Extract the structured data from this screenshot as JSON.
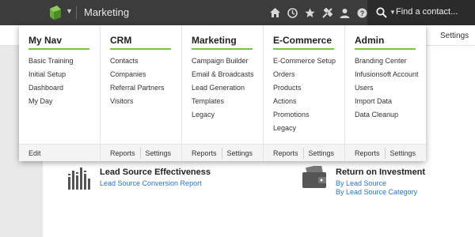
{
  "header": {
    "app_title": "Marketing",
    "search_placeholder": "Find a contact...",
    "icons": [
      "home-icon",
      "history-icon",
      "star-icon",
      "tools-icon",
      "user-icon",
      "help-icon"
    ]
  },
  "subbar": {
    "settings_label": "Settings"
  },
  "menu": {
    "columns": [
      {
        "title": "My Nav",
        "items": [
          "Basic Training",
          "Initial Setup",
          "Dashboard",
          "My Day"
        ],
        "footer": [
          "Edit"
        ]
      },
      {
        "title": "CRM",
        "items": [
          "Contacts",
          "Companies",
          "Referral Partners",
          "Visitors"
        ],
        "footer": [
          "Reports",
          "Settings"
        ]
      },
      {
        "title": "Marketing",
        "items": [
          "Campaign Builder",
          "Email & Broadcasts",
          "Lead Generation",
          "Templates",
          "Legacy"
        ],
        "footer": [
          "Reports",
          "Settings"
        ]
      },
      {
        "title": "E-Commerce",
        "items": [
          "E-Commerce Setup",
          "Orders",
          "Products",
          "Actions",
          "Promotions",
          "Legacy"
        ],
        "footer": [
          "Reports",
          "Settings"
        ]
      },
      {
        "title": "Admin",
        "items": [
          "Branding Center",
          "Infusionsoft Account",
          "Users",
          "Import Data",
          "Data Cleanup"
        ],
        "footer": [
          "Reports",
          "Settings"
        ]
      }
    ]
  },
  "widgets": {
    "lead_source": {
      "title": "Lead Source Effectiveness",
      "links": [
        "Lead Source Conversion Report"
      ]
    },
    "roi": {
      "title": "Return on Investment",
      "links": [
        "By Lead Source",
        "By Lead Source Category"
      ]
    }
  },
  "colors": {
    "accent": "#7dc142",
    "topbar": "#3c3c3c",
    "link": "#2b73c8"
  }
}
